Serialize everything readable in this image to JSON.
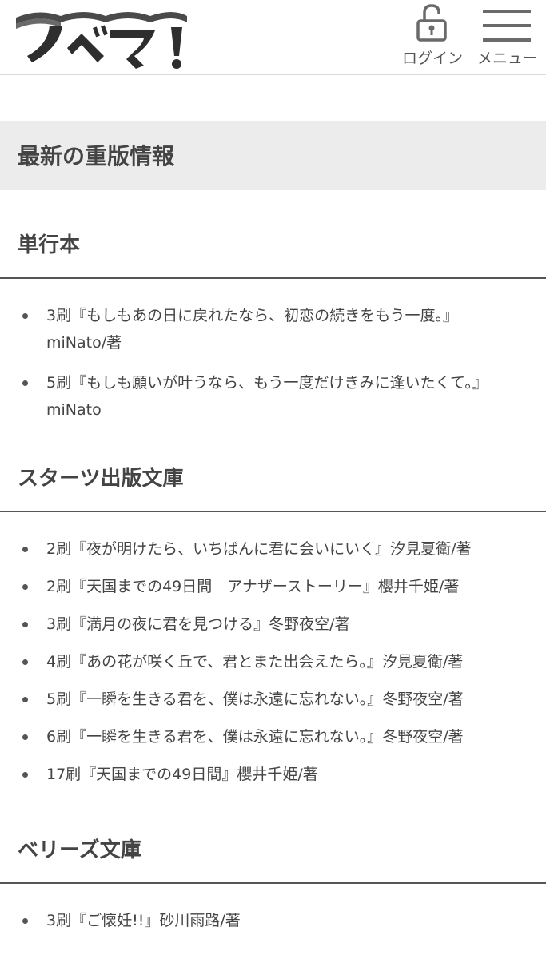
{
  "header": {
    "logo_text": "ノベマ!",
    "login_label": "ログイン",
    "menu_label": "メニュー"
  },
  "section_title": "最新の重版情報",
  "categories": [
    {
      "title": "単行本",
      "items": [
        "3刷『もしもあの日に戻れたなら、初恋の続きをもう一度。』miNato/著",
        "5刷『もしも願いが叶うなら、もう一度だけきみに逢いたくて。』miNato"
      ]
    },
    {
      "title": "スターツ出版文庫",
      "items": [
        "2刷『夜が明けたら、いちばんに君に会いにいく』汐見夏衛/著",
        "2刷『天国までの49日間　アナザーストーリー』櫻井千姫/著",
        "3刷『満月の夜に君を見つける』冬野夜空/著",
        "4刷『あの花が咲く丘で、君とまた出会えたら。』汐見夏衛/著",
        "5刷『一瞬を生きる君を、僕は永遠に忘れない。』冬野夜空/著",
        "6刷『一瞬を生きる君を、僕は永遠に忘れない。』冬野夜空/著",
        "17刷『天国までの49日間』櫻井千姫/著"
      ]
    },
    {
      "title": "ベリーズ文庫",
      "items": [
        "3刷『ご懐妊!!』砂川雨路/著"
      ]
    }
  ]
}
